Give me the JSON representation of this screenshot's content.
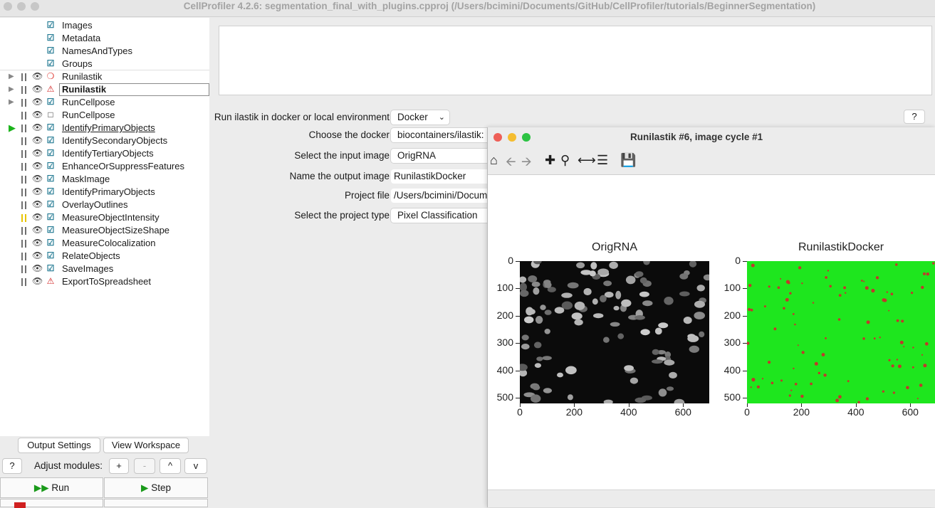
{
  "window": {
    "title": "CellProfiler 4.2.6: segmentation_final_with_plugins.cpproj (/Users/bcimini/Documents/GitHub/CellProfiler/tutorials/BeginnerSegmentation)"
  },
  "pipeline": {
    "input_modules": [
      "Images",
      "Metadata",
      "NamesAndTypes",
      "Groups"
    ],
    "modules": [
      {
        "name": "Runilastik",
        "status_icon": "error-icon",
        "expandable": true
      },
      {
        "name": "Runilastik",
        "status_icon": "warning-icon",
        "expandable": true,
        "selected": true
      },
      {
        "name": "RunCellpose",
        "status_icon": "check-icon",
        "expandable": true
      },
      {
        "name": "RunCellpose",
        "status_icon": "square-icon",
        "expandable": false
      },
      {
        "name": "IdentifyPrimaryObjects",
        "status_icon": "check-icon",
        "current": true
      },
      {
        "name": "IdentifySecondaryObjects",
        "status_icon": "check-icon"
      },
      {
        "name": "IdentifyTertiaryObjects",
        "status_icon": "check-icon"
      },
      {
        "name": "EnhanceOrSuppressFeatures",
        "status_icon": "check-icon"
      },
      {
        "name": "MaskImage",
        "status_icon": "check-icon"
      },
      {
        "name": "IdentifyPrimaryObjects",
        "status_icon": "check-icon"
      },
      {
        "name": "OverlayOutlines",
        "status_icon": "check-icon"
      },
      {
        "name": "MeasureObjectIntensity",
        "status_icon": "check-icon",
        "pause_yellow": true
      },
      {
        "name": "MeasureObjectSizeShape",
        "status_icon": "check-icon"
      },
      {
        "name": "MeasureColocalization",
        "status_icon": "check-icon"
      },
      {
        "name": "RelateObjects",
        "status_icon": "check-icon"
      },
      {
        "name": "SaveImages",
        "status_icon": "check-icon"
      },
      {
        "name": "ExportToSpreadsheet",
        "status_icon": "warning-icon"
      }
    ]
  },
  "buttons": {
    "output_settings": "Output Settings",
    "view_workspace": "View Workspace",
    "help": "?",
    "adjust_modules": "Adjust modules:",
    "add": "+",
    "remove": "-",
    "up": "^",
    "down": "v",
    "run": "Run",
    "step": "Step"
  },
  "settings": [
    {
      "label": "Run ilastik in docker or local environment",
      "value": "Docker",
      "type": "select"
    },
    {
      "label": "Choose the docker",
      "value": "biocontainers/ilastik:",
      "type": "select"
    },
    {
      "label": "Select the input image",
      "value": "OrigRNA",
      "type": "select"
    },
    {
      "label": "Name the output image",
      "value": "RunilastikDocker",
      "type": "text"
    },
    {
      "label": "Project file",
      "value": "/Users/bcimini/Docum",
      "type": "text"
    },
    {
      "label": "Select the project type",
      "value": "Pixel Classification",
      "type": "select"
    }
  ],
  "settings_help": "?",
  "figure": {
    "title": "Runilastik #6, image cycle #1",
    "panels": [
      {
        "title": "OrigRNA",
        "yticks": [
          "0",
          "100",
          "200",
          "300",
          "400",
          "500"
        ],
        "xticks": [
          "0",
          "200",
          "400",
          "600"
        ]
      },
      {
        "title": "RunilastikDocker",
        "yticks": [
          "0",
          "100",
          "200",
          "300",
          "400",
          "500"
        ],
        "xticks": [
          "0",
          "200",
          "400",
          "600"
        ]
      }
    ]
  }
}
